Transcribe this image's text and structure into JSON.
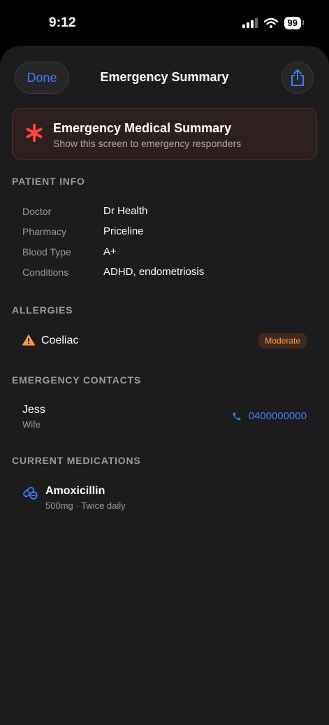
{
  "status_bar": {
    "time": "9:12",
    "battery": "99"
  },
  "nav": {
    "done_label": "Done",
    "title": "Emergency Summary"
  },
  "banner": {
    "title": "Emergency Medical Summary",
    "subtitle": "Show this screen to emergency responders"
  },
  "patient_info": {
    "header": "PATIENT INFO",
    "rows": [
      {
        "label": "Doctor",
        "value": "Dr Health"
      },
      {
        "label": "Pharmacy",
        "value": "Priceline"
      },
      {
        "label": "Blood Type",
        "value": "A+"
      },
      {
        "label": "Conditions",
        "value": "ADHD, endometriosis"
      }
    ]
  },
  "allergies": {
    "header": "ALLERGIES",
    "items": [
      {
        "name": "Coeliac",
        "severity": "Moderate",
        "icon": "warning-icon"
      }
    ]
  },
  "emergency_contacts": {
    "header": "EMERGENCY CONTACTS",
    "items": [
      {
        "name": "Jess",
        "relation": "Wife",
        "phone": "0400000000",
        "icon": "phone-icon"
      }
    ]
  },
  "medications": {
    "header": "CURRENT MEDICATIONS",
    "items": [
      {
        "name": "Amoxicillin",
        "detail": "500mg · Twice daily",
        "icon": "pill-icon"
      }
    ]
  },
  "colors": {
    "accent": "#3c7dfa",
    "alert_red": "#ff453a",
    "warning_orange": "#ff9a3d"
  }
}
